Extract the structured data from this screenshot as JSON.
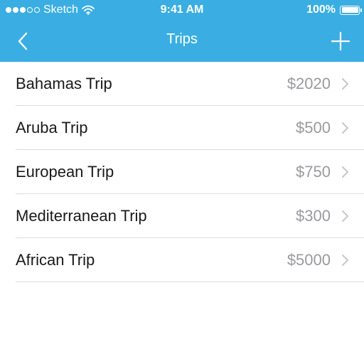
{
  "status_bar": {
    "carrier": "Sketch",
    "time": "9:41 AM",
    "battery": "100%",
    "signal_bars_filled": 3,
    "signal_bars_total": 5
  },
  "nav": {
    "title": "Trips"
  },
  "trips": [
    {
      "name": "Bahamas Trip",
      "amount": "$2020"
    },
    {
      "name": "Aruba Trip",
      "amount": "$500"
    },
    {
      "name": "European Trip",
      "amount": "$750"
    },
    {
      "name": "Mediterranean Trip",
      "amount": "$300"
    },
    {
      "name": "African Trip",
      "amount": "$5000"
    }
  ],
  "colors": {
    "header_background": "#3aaee2",
    "header_text": "#ffffff",
    "trip_name": "#1a1a1a",
    "trip_amount": "#9a9a9f",
    "chevron": "#c7c7cc",
    "separator": "#dcdcdc"
  },
  "icons": {
    "back": "chevron-left-icon",
    "add": "plus-icon",
    "wifi": "wifi-icon",
    "battery": "battery-icon",
    "disclosure": "chevron-right-icon"
  }
}
